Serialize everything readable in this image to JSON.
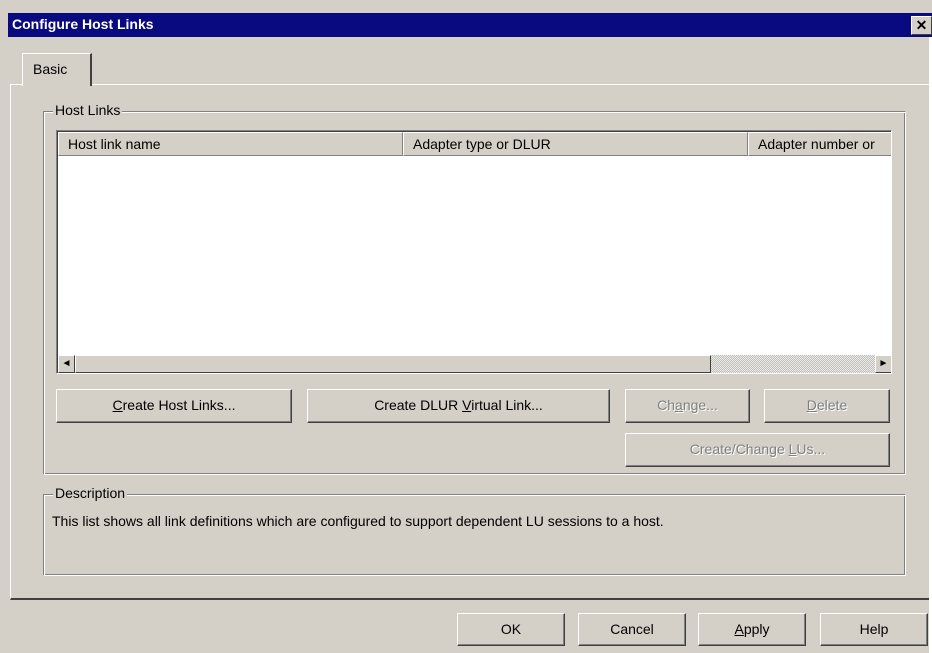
{
  "window": {
    "title": "Configure Host Links",
    "close_glyph": "✕"
  },
  "tabs": [
    {
      "label": "Basic",
      "selected": true
    }
  ],
  "host_links_group": {
    "title": "Host Links",
    "columns": [
      "Host link name",
      "Adapter type or DLUR",
      "Adapter number or"
    ],
    "rows": [],
    "scrollbar": {
      "left_arrow": "◄",
      "right_arrow": "►"
    },
    "buttons": {
      "create_host_links": {
        "pre": "",
        "mn": "C",
        "post": "reate Host Links...",
        "enabled": true
      },
      "create_dlur": {
        "pre": "Create DLUR ",
        "mn": "V",
        "post": "irtual Link...",
        "enabled": true
      },
      "change": {
        "pre": "Ch",
        "mn": "a",
        "post": "nge...",
        "enabled": false
      },
      "delete": {
        "pre": "",
        "mn": "D",
        "post": "elete",
        "enabled": false
      },
      "create_change_lus": {
        "pre": "Create/Change ",
        "mn": "L",
        "post": "Us...",
        "enabled": false
      }
    }
  },
  "description_group": {
    "title": "Description",
    "text": "This list shows all link definitions which are configured to support dependent LU sessions to a host."
  },
  "footer_buttons": {
    "ok": "OK",
    "cancel": "Cancel",
    "apply": {
      "pre": "",
      "mn": "A",
      "post": "pply"
    },
    "help": "Help"
  },
  "colors": {
    "titlebar": "#0a0a80",
    "face": "#d4d0c8",
    "disabled_text": "#808080"
  }
}
